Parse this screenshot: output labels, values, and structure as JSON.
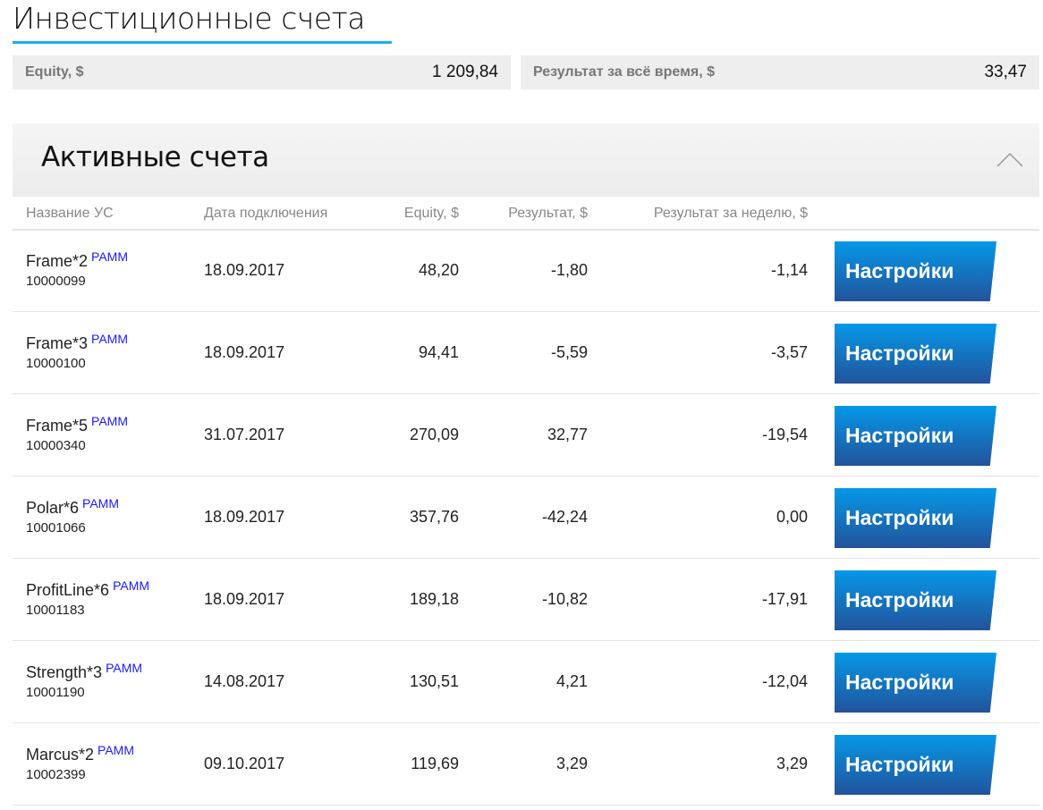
{
  "title": "Инвестиционные счета",
  "summary": {
    "equity_label": "Equity, $",
    "equity_value": "1 209,84",
    "result_label": "Результат за всё время, $",
    "result_value": "33,47"
  },
  "panel": {
    "title": "Активные счета"
  },
  "columns": [
    "Название УС",
    "Дата подключения",
    "Equity, $",
    "Результат, $",
    "Результат за неделю, $"
  ],
  "button_label": "Настройки",
  "rows": [
    {
      "name": "Frame*2",
      "tag": "PAMM",
      "id": "10000099",
      "date": "18.09.2017",
      "equity": "48,20",
      "result": "-1,80",
      "week": "-1,14"
    },
    {
      "name": "Frame*3",
      "tag": "PAMM",
      "id": "10000100",
      "date": "18.09.2017",
      "equity": "94,41",
      "result": "-5,59",
      "week": "-3,57"
    },
    {
      "name": "Frame*5",
      "tag": "PAMM",
      "id": "10000340",
      "date": "31.07.2017",
      "equity": "270,09",
      "result": "32,77",
      "week": "-19,54"
    },
    {
      "name": "Polar*6",
      "tag": "PAMM",
      "id": "10001066",
      "date": "18.09.2017",
      "equity": "357,76",
      "result": "-42,24",
      "week": "0,00"
    },
    {
      "name": "ProfitLine*6",
      "tag": "PAMM",
      "id": "10001183",
      "date": "18.09.2017",
      "equity": "189,18",
      "result": "-10,82",
      "week": "-17,91"
    },
    {
      "name": "Strength*3",
      "tag": "PAMM",
      "id": "10001190",
      "date": "14.08.2017",
      "equity": "130,51",
      "result": "4,21",
      "week": "-12,04"
    },
    {
      "name": "Marcus*2",
      "tag": "PAMM",
      "id": "10002399",
      "date": "09.10.2017",
      "equity": "119,69",
      "result": "3,29",
      "week": "3,29"
    }
  ]
}
